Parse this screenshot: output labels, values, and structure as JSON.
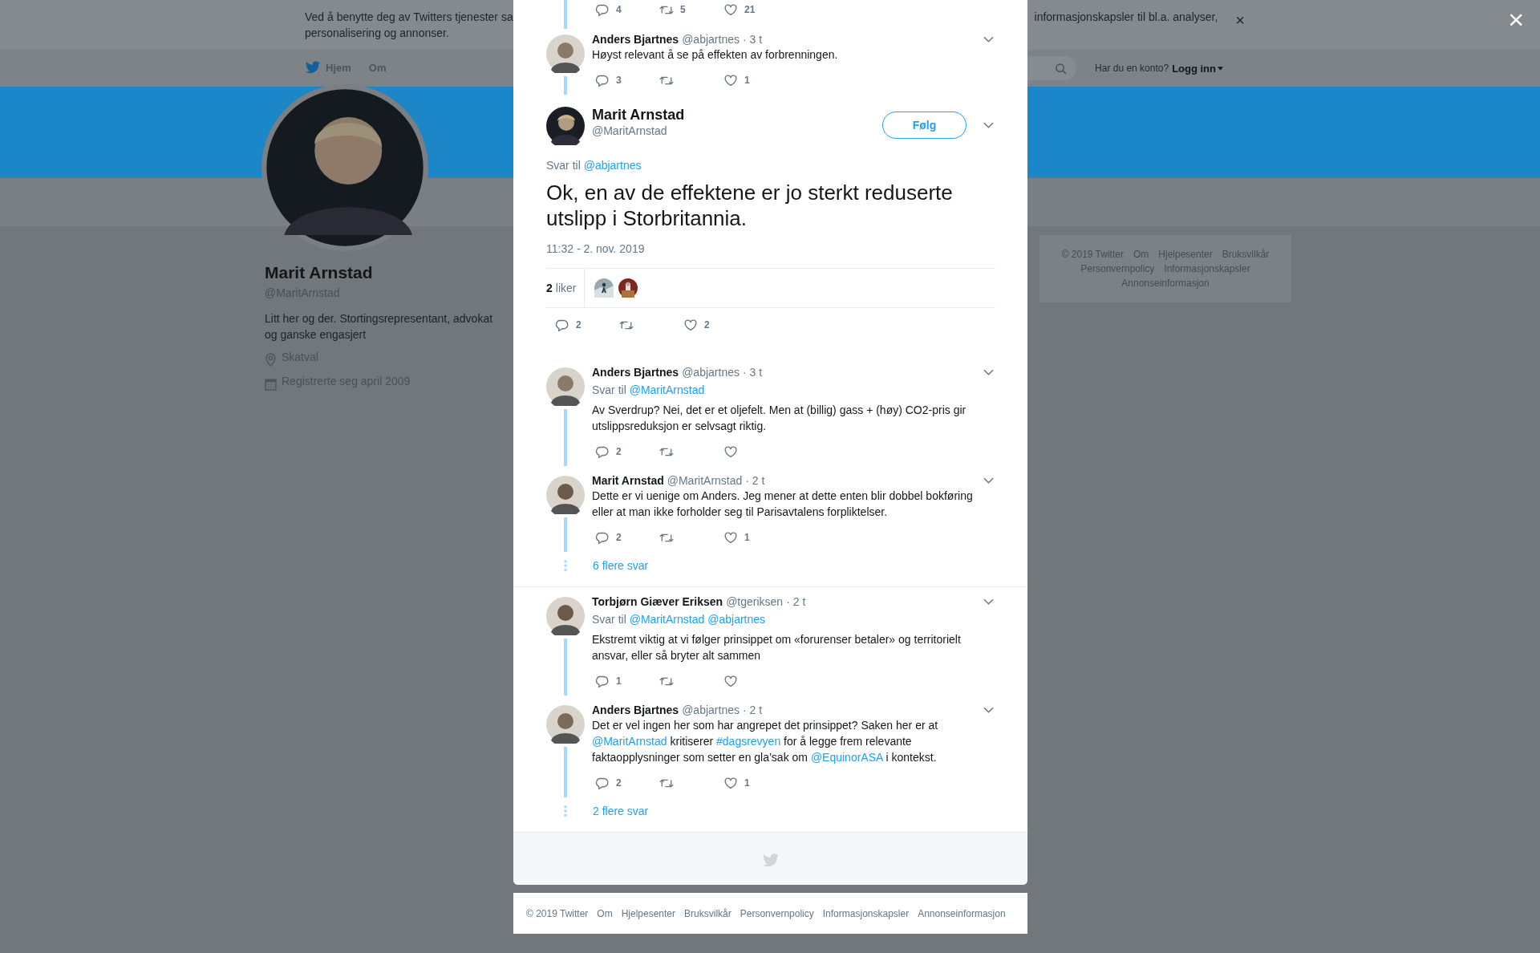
{
  "cookie_banner": {
    "text_left": "Ved å benytte deg av Twitters tjenester sa",
    "text_right": "informasjonskapsler til bl.a. analyser,",
    "text_line2": "personalisering og annonser.",
    "close": "×"
  },
  "overlay_close": "×",
  "nav": {
    "items": [
      {
        "label": "Hjem"
      },
      {
        "label": "Om"
      }
    ],
    "login_prompt": "Har du en konto?",
    "login": "Logg inn"
  },
  "profile": {
    "name": "Marit Arnstad",
    "handle": "@MaritArnstad",
    "bio": "Litt her og der. Stortingsrepresentant, advokat og ganske engasjert",
    "location": "Skatval",
    "joined": "Registrerte seg april 2009"
  },
  "sidebar_footer": [
    "© 2019 Twitter",
    "Om",
    "Hjelpesenter",
    "Bruksvilkår",
    "Personvernpolicy",
    "Informasjonskapsler",
    "Annonseinformasjon"
  ],
  "modal": {
    "parent_stats": {
      "replies": "4",
      "retweets": "5",
      "likes": "21"
    },
    "thread_before": [
      {
        "name": "Anders Bjartnes",
        "handle": "@abjartnes",
        "time": "· 3 t",
        "text": [
          {
            "kind": "text",
            "text": "Høyst relevant å se på effekten av forbrenningen."
          }
        ],
        "stats": {
          "replies": "3",
          "likes": "1"
        }
      }
    ],
    "focus": {
      "name": "Marit Arnstad",
      "handle": "@MaritArnstad",
      "follow": "Følg",
      "reply_label": "Svar til",
      "reply_to": [
        "@abjartnes"
      ],
      "text": "Ok, en av de effektene er jo sterkt reduserte utslipp i Storbritannia.",
      "date": "11:32 - 2. nov. 2019",
      "likes_count": "2",
      "likes_label": "liker",
      "stats": {
        "replies": "2",
        "likes": "2"
      }
    },
    "reply_groups": [
      {
        "tweets": [
          {
            "name": "Anders Bjartnes",
            "handle": "@abjartnes",
            "time": "· 3 t",
            "reply_label": "Svar til",
            "reply_to": [
              "@MaritArnstad"
            ],
            "text": [
              {
                "kind": "text",
                "text": "Av Sverdrup? Nei, det er et oljefelt. Men at (billig) gass + (høy) CO2-pris gir utslippsreduksjon er selvsagt riktig."
              }
            ],
            "stats": {
              "replies": "2"
            }
          },
          {
            "name": "Marit Arnstad",
            "handle": "@MaritArnstad",
            "time": "· 2 t",
            "text": [
              {
                "kind": "text",
                "text": "Dette er vi uenige om Anders. Jeg mener at dette enten blir dobbel bokføring eller at man ikke forholder seg til Parisavtalens forpliktelser."
              }
            ],
            "stats": {
              "replies": "2",
              "likes": "1"
            }
          }
        ],
        "more": "6 flere svar"
      },
      {
        "tweets": [
          {
            "name": "Torbjørn Giæver Eriksen",
            "handle": "@tgeriksen",
            "time": "· 2 t",
            "reply_label": "Svar til",
            "reply_to": [
              "@MaritArnstad",
              "@abjartnes"
            ],
            "text": [
              {
                "kind": "text",
                "text": "Ekstremt viktig at vi følger prinsippet om «forurenser betaler» og territorielt ansvar, eller så bryter alt sammen"
              }
            ],
            "stats": {
              "replies": "1"
            }
          },
          {
            "name": "Anders Bjartnes",
            "handle": "@abjartnes",
            "time": "· 2 t",
            "text": [
              {
                "kind": "text",
                "text": "Det er vel ingen her som har angrepet det prinsippet? Saken her er at "
              },
              {
                "kind": "mention",
                "text": "@MaritArnstad"
              },
              {
                "kind": "text",
                "text": " kritiserer "
              },
              {
                "kind": "hashtag",
                "text": "#dagsrevyen"
              },
              {
                "kind": "text",
                "text": " for å legge frem relevante faktaopplysninger som setter en gla’sak om "
              },
              {
                "kind": "mention",
                "text": "@EquinorASA"
              },
              {
                "kind": "text",
                "text": " i kontekst."
              }
            ],
            "stats": {
              "replies": "2",
              "likes": "1"
            }
          }
        ],
        "more": "2 flere svar"
      }
    ]
  },
  "footer_links": [
    "© 2019 Twitter",
    "Om",
    "Hjelpesenter",
    "Bruksvilkår",
    "Personvernpolicy",
    "Informasjonskapsler",
    "Annonseinformasjon"
  ]
}
